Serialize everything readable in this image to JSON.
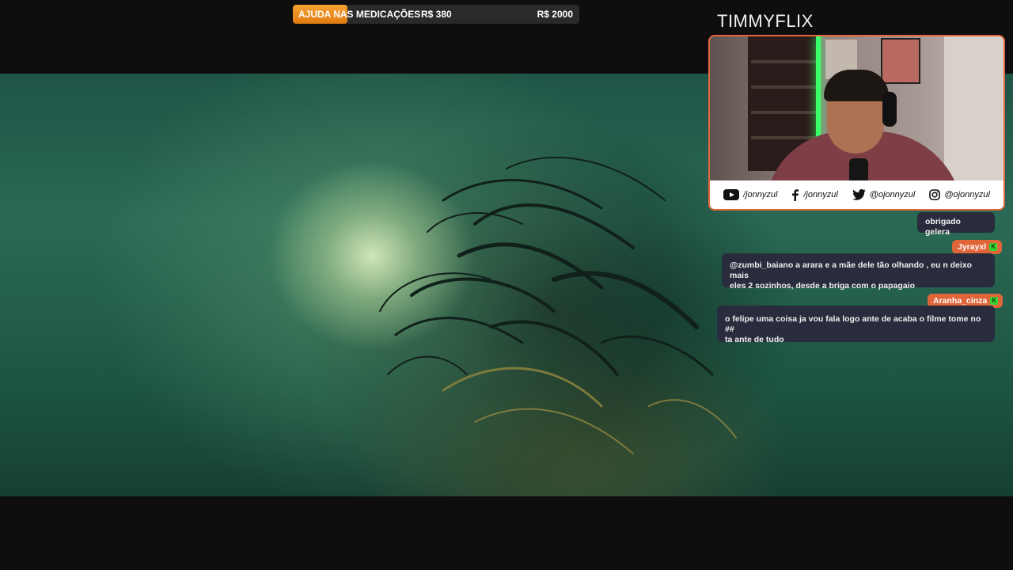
{
  "goal": {
    "title": "AJUDA NAS MEDICAÇÕES",
    "current": "R$ 380",
    "target": "R$ 2000",
    "progress": 0.19,
    "color": "#f39a28"
  },
  "channel": {
    "name": "TIMMYFLIX"
  },
  "socials": [
    {
      "icon": "youtube-icon",
      "handle": "/jonnyzul"
    },
    {
      "icon": "facebook-icon",
      "handle": "/jonnyzul"
    },
    {
      "icon": "twitter-icon",
      "handle": "@ojonnyzul"
    },
    {
      "icon": "instagram-icon",
      "handle": "@ojonnyzul"
    }
  ],
  "chat": {
    "messages": [
      {
        "author": "",
        "text": "obrigado gelera"
      },
      {
        "author": "Jyrayxl",
        "badge": "K",
        "name_color": "#e0663a",
        "text_line1": "@zumbi_baiano a arara e a mãe dele tão olhando , eu n deixo mais",
        "text_line2": "eles 2 sozinhos, desde a briga com o papagaio"
      },
      {
        "author": "Aranha_cinza",
        "badge": "K",
        "name_color": "#e0663a",
        "text_line1": "o felipe uma coisa ja vou fala logo ante de acaba o filme tome no ##",
        "text_line2": "ta ante de tudo"
      }
    ]
  }
}
